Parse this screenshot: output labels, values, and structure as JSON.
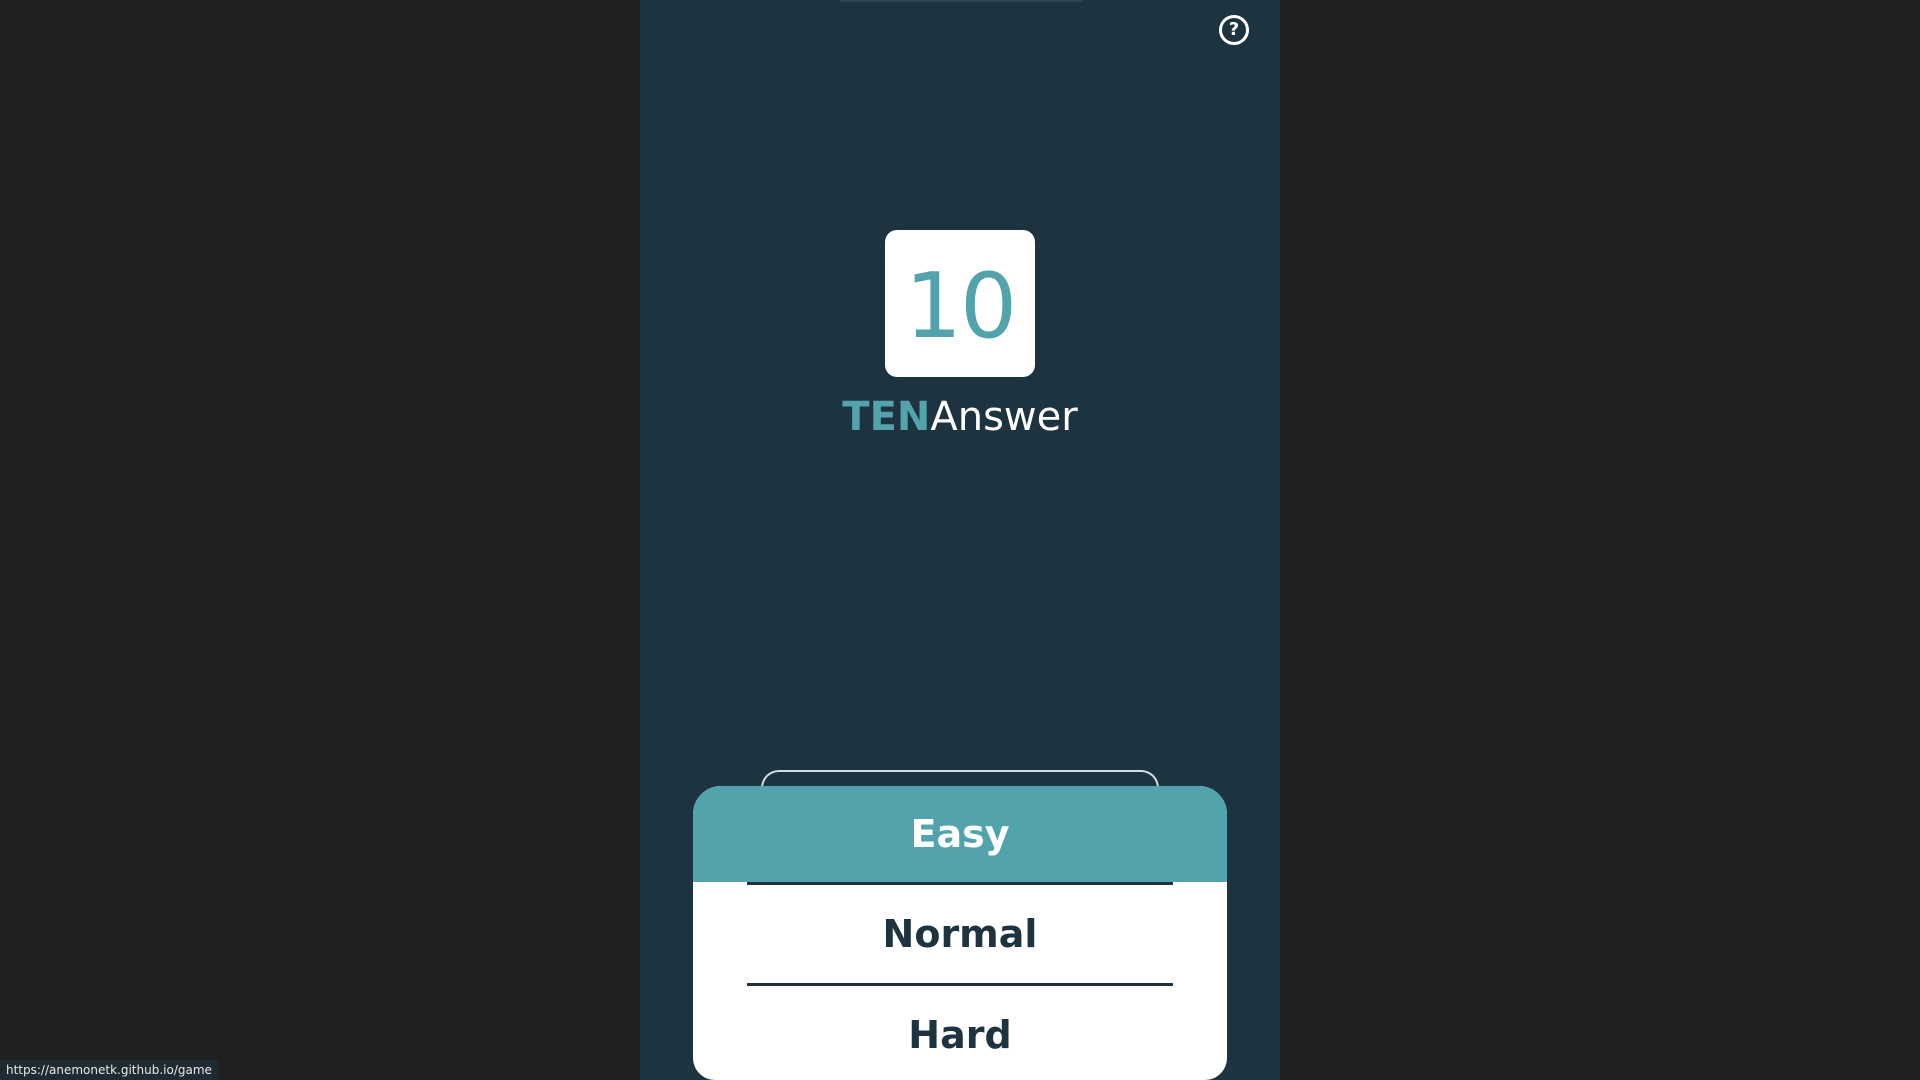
{
  "header": {
    "help_label": "?"
  },
  "logo": {
    "number": "10",
    "accent_text": "TEN",
    "rest_text": "Answer"
  },
  "difficulty": {
    "options": [
      "Easy",
      "Normal",
      "Hard"
    ],
    "selected": "Easy"
  },
  "status_bar": {
    "url": "https://anemonetk.github.io/game"
  },
  "colors": {
    "page_background": "#202020",
    "app_background": "#1e3340",
    "accent": "#52a3ac",
    "card": "#ffffff"
  }
}
